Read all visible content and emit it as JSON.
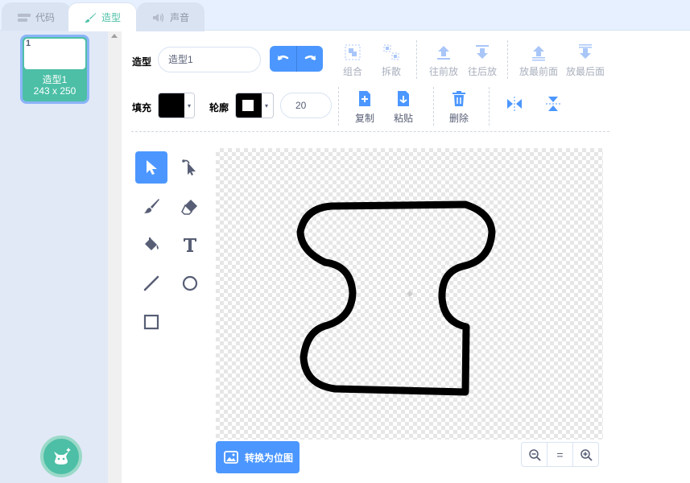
{
  "tabs": [
    {
      "label": "代码",
      "icon": "code-blocks-icon"
    },
    {
      "label": "造型",
      "icon": "brush-icon"
    },
    {
      "label": "声音",
      "icon": "speaker-icon"
    }
  ],
  "costume_list": {
    "items": [
      {
        "number": "1",
        "name": "造型1",
        "size": "243 x 250"
      }
    ],
    "add_icon": "cat-add-icon"
  },
  "toolbar": {
    "costume_label": "造型",
    "costume_name": "造型1",
    "group_label": "组合",
    "ungroup_label": "拆散",
    "forward_label": "往前放",
    "backward_label": "往后放",
    "front_label": "放最前面",
    "back_label": "放最后面",
    "fill_label": "填充",
    "outline_label": "轮廓",
    "stroke_width": "20",
    "copy_label": "复制",
    "paste_label": "粘贴",
    "delete_label": "删除"
  },
  "colors": {
    "accent": "#4c97ff",
    "tab_active": "#4cbfa6",
    "fill_color": "#000000",
    "outline_color": "#000000"
  },
  "tools": [
    "select-icon",
    "reshape-icon",
    "brush-icon",
    "eraser-icon",
    "fill-icon",
    "text-icon",
    "line-icon",
    "circle-icon",
    "rectangle-icon"
  ],
  "bottom": {
    "convert_label": "转换为位图",
    "zoom_out": "−",
    "zoom_reset": "=",
    "zoom_in": "+"
  }
}
